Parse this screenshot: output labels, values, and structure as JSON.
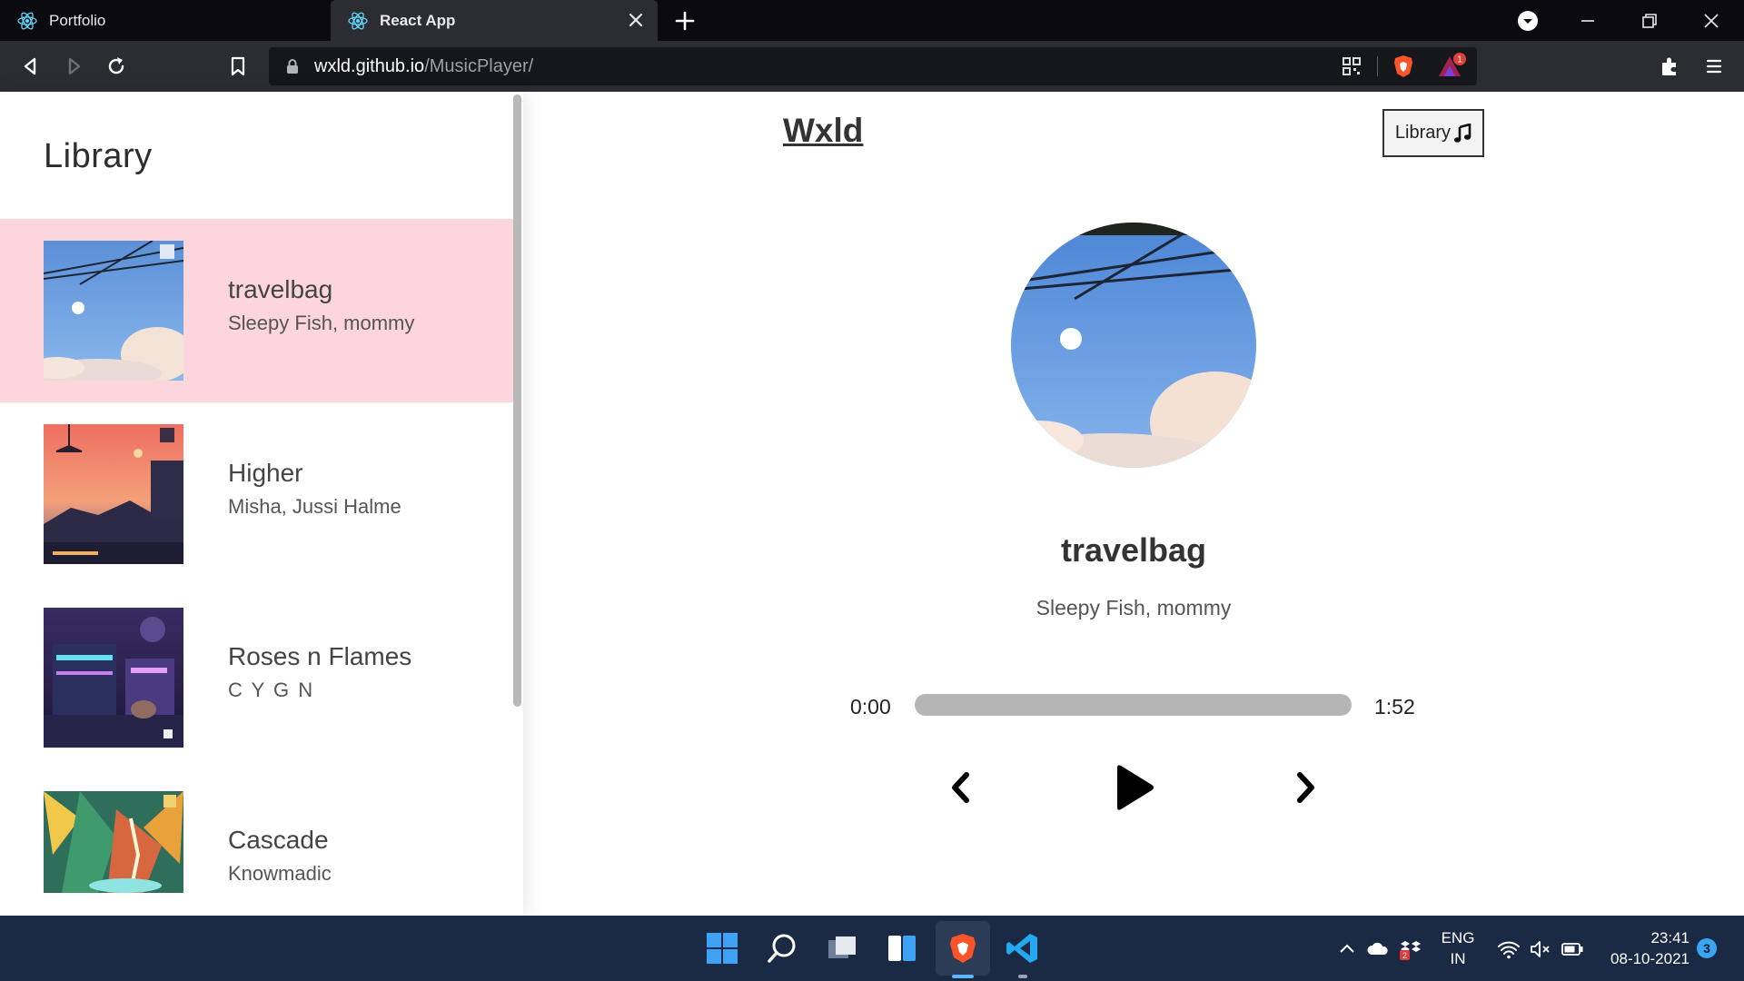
{
  "browser": {
    "tabs": [
      {
        "title": "Portfolio",
        "active": false
      },
      {
        "title": "React App",
        "active": true
      }
    ],
    "url_host": "wxld.github.io",
    "url_path": "/MusicPlayer/",
    "notification_count": "1"
  },
  "library": {
    "title": "Library",
    "songs": [
      {
        "name": "travelbag",
        "artist": "Sleepy Fish, mommy",
        "active": true
      },
      {
        "name": "Higher",
        "artist": "Misha, Jussi Halme",
        "active": false
      },
      {
        "name": "Roses n Flames",
        "artist": "C Y G N",
        "active": false
      },
      {
        "name": "Cascade",
        "artist": "Knowmadic",
        "active": false
      }
    ]
  },
  "player": {
    "logo": "Wxld",
    "library_button": "Library",
    "current_song": "travelbag",
    "current_artist": "Sleepy Fish, mommy",
    "time_current": "0:00",
    "time_total": "1:52",
    "progress": 0
  },
  "taskbar": {
    "lang_line1": "ENG",
    "lang_line2": "IN",
    "time": "23:41",
    "date": "08-10-2021",
    "notifications": "3",
    "dropbox_badge": "2"
  },
  "colors": {
    "active_song_bg": "#fdd5dc",
    "track": "#b5b5b5",
    "taskbar": "#1b2a44",
    "brave_orange": "#fb542b",
    "vscode_blue": "#23a9f2"
  },
  "icons": [
    "react-icon",
    "close-icon",
    "plus-icon",
    "dropdown-icon",
    "minimize-icon",
    "restore-icon",
    "back-icon",
    "forward-icon",
    "reload-icon",
    "bookmark-icon",
    "lock-icon",
    "qr-icon",
    "brave-shield-icon",
    "brave-rewards-icon",
    "extensions-icon",
    "menu-icon",
    "music-note-icon",
    "prev-icon",
    "play-icon",
    "next-icon",
    "windows-start-icon",
    "search-icon",
    "task-view-icon",
    "widgets-icon",
    "brave-icon",
    "vscode-icon",
    "chevron-up-icon",
    "cloud-icon",
    "dropbox-icon",
    "wifi-icon",
    "mute-icon",
    "battery-icon"
  ]
}
